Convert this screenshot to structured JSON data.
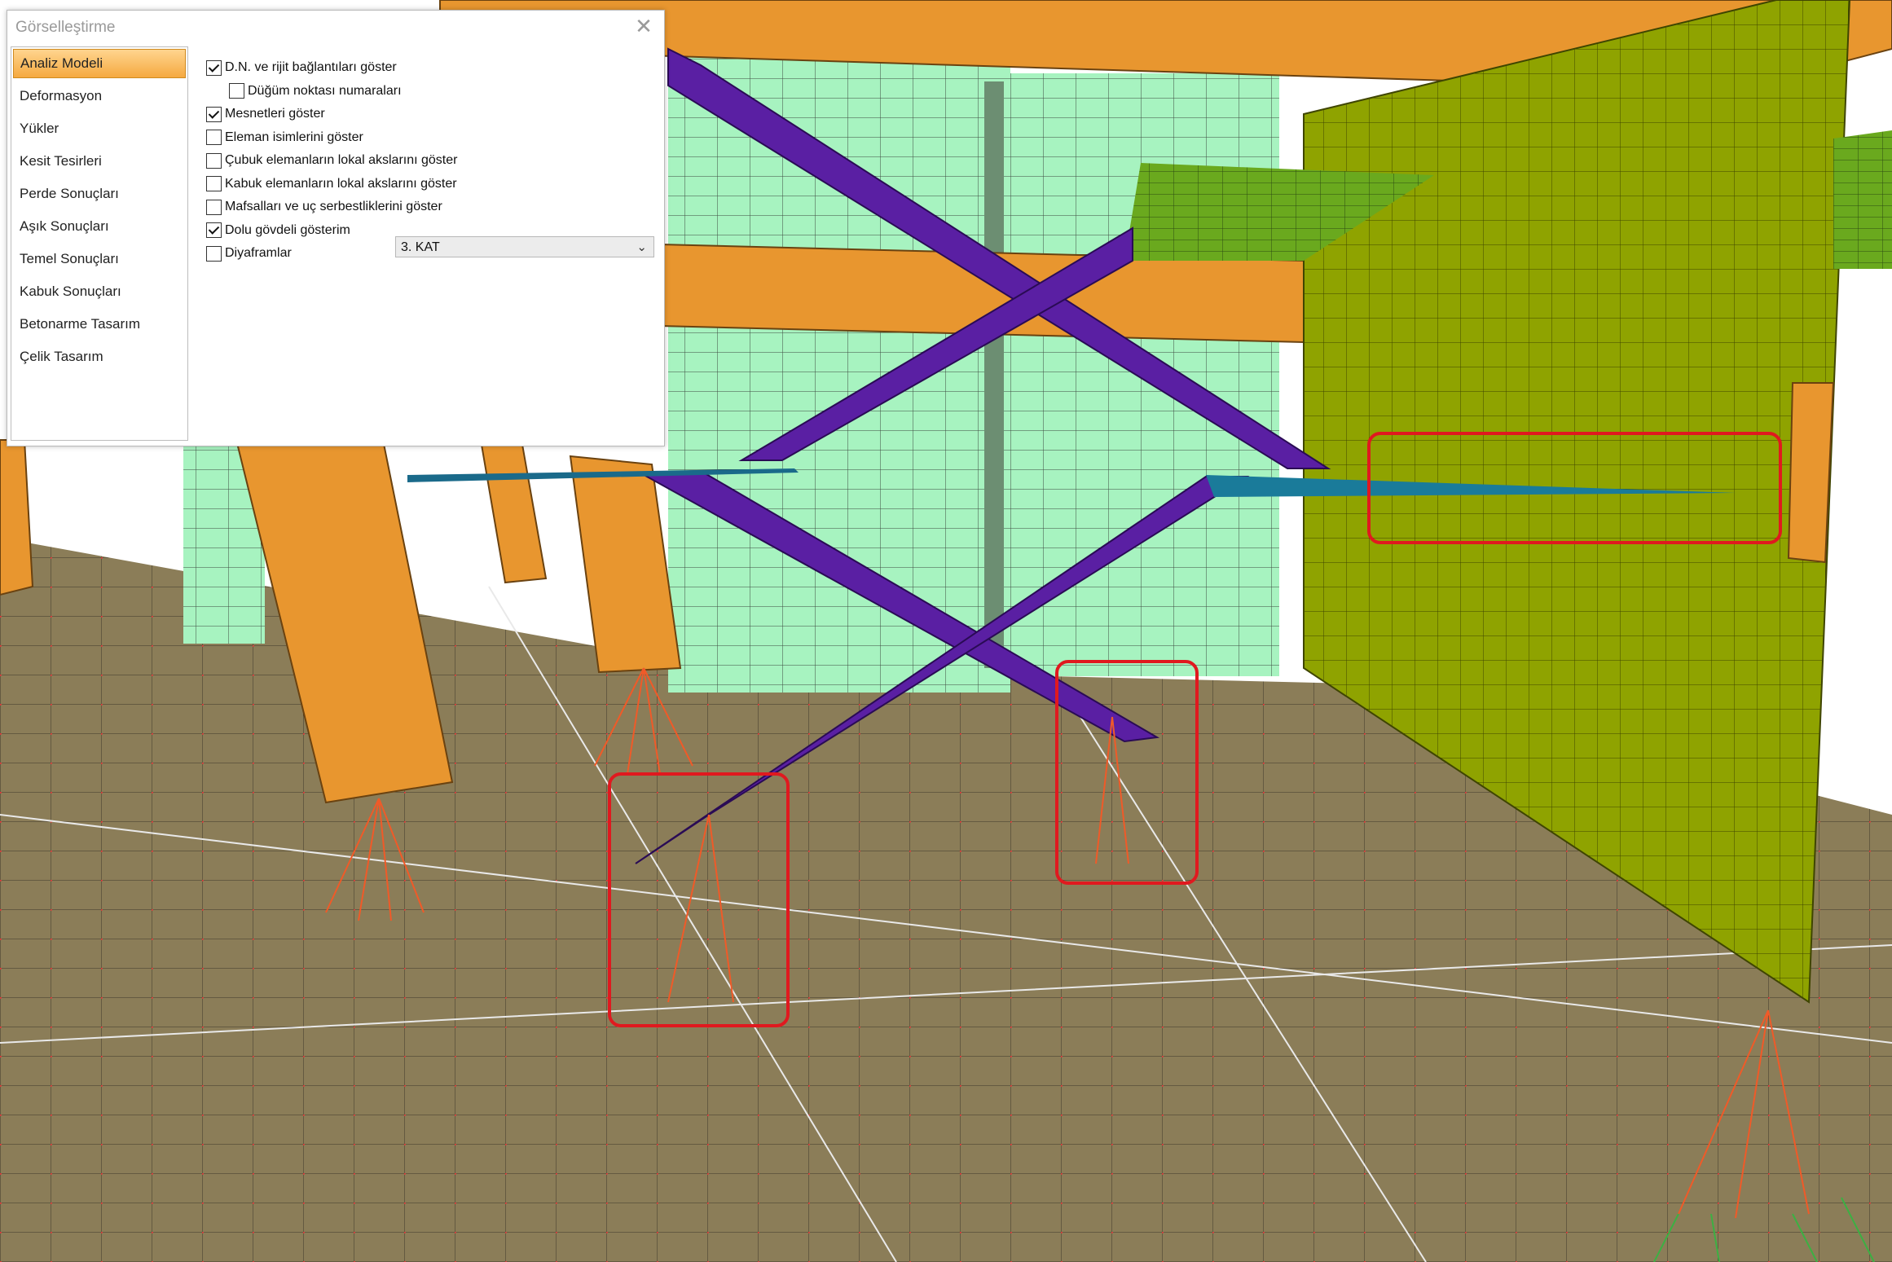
{
  "dialog": {
    "title": "Görselleştirme",
    "close_glyph": "✕",
    "menu": [
      {
        "label": "Analiz Modeli",
        "active": true
      },
      {
        "label": "Deformasyon"
      },
      {
        "label": "Yükler"
      },
      {
        "label": "Kesit Tesirleri"
      },
      {
        "label": "Perde Sonuçları"
      },
      {
        "label": "Aşık Sonuçları"
      },
      {
        "label": "Temel Sonuçları"
      },
      {
        "label": "Kabuk Sonuçları"
      },
      {
        "label": "Betonarme Tasarım"
      },
      {
        "label": "Çelik Tasarım"
      }
    ],
    "options": [
      {
        "label": "D.N. ve rijit bağlantıları göster",
        "checked": true
      },
      {
        "label": "Düğüm noktası numaraları",
        "checked": false,
        "indent": true
      },
      {
        "label": "Mesnetleri göster",
        "checked": true
      },
      {
        "label": "Eleman isimlerini göster",
        "checked": false
      },
      {
        "label": "Çubuk elemanların lokal akslarını göster",
        "checked": false
      },
      {
        "label": "Kabuk elemanların lokal akslarını göster",
        "checked": false
      },
      {
        "label": "Mafsalları ve uç serbestliklerini göster",
        "checked": false
      },
      {
        "label": "Dolu gövdeli gösterim",
        "checked": true
      },
      {
        "label": "Diyaframlar",
        "checked": false
      }
    ],
    "floor_select": {
      "value": "3. KAT",
      "icon": "chevron-down-icon"
    }
  },
  "colors": {
    "orange": "#e8962f",
    "light_green": "#a6f2c0",
    "olive": "#93a500",
    "purple": "#5a1fa3",
    "ground": "#8b7d58",
    "highlight": "#e0191f"
  }
}
